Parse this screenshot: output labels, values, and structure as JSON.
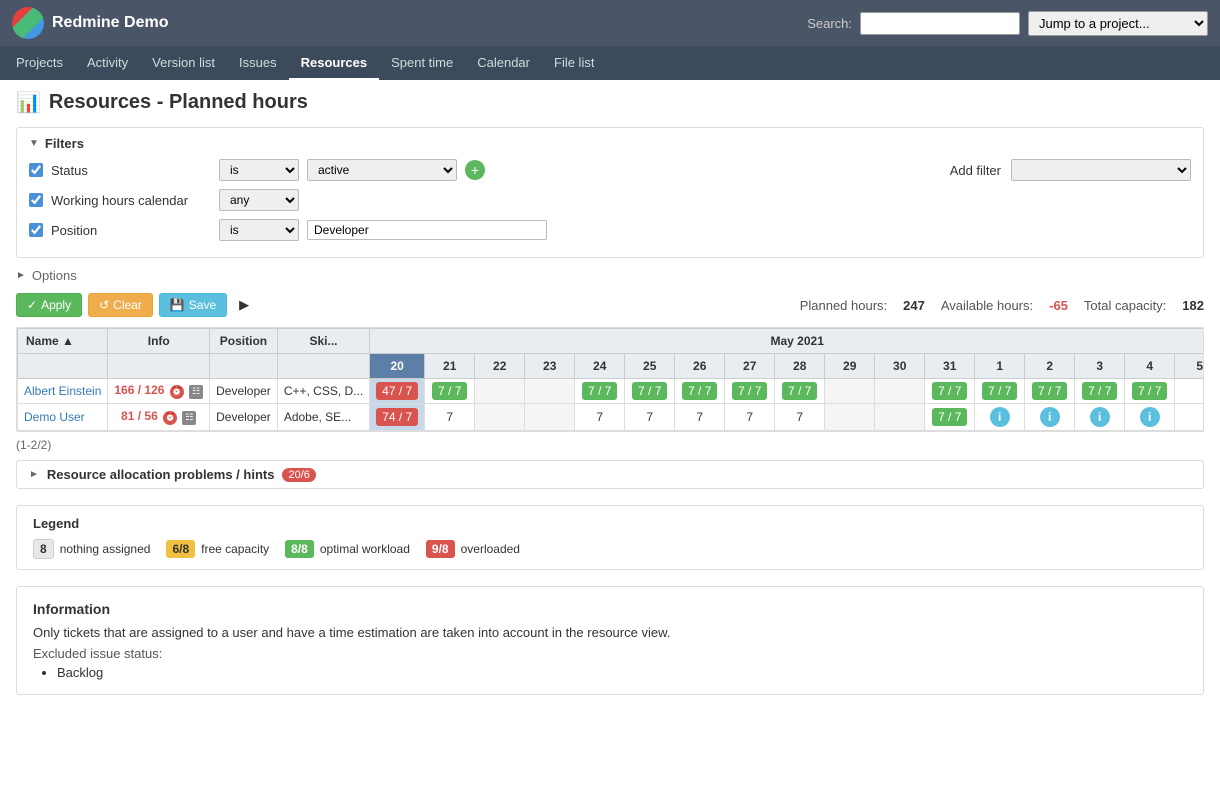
{
  "app": {
    "title": "Redmine Demo",
    "search_label": "Search:",
    "search_placeholder": "",
    "jump_placeholder": "Jump to a project..."
  },
  "nav": {
    "items": [
      {
        "label": "Projects",
        "active": false
      },
      {
        "label": "Activity",
        "active": false
      },
      {
        "label": "Version list",
        "active": false
      },
      {
        "label": "Issues",
        "active": false
      },
      {
        "label": "Resources",
        "active": true
      },
      {
        "label": "Spent time",
        "active": false
      },
      {
        "label": "Calendar",
        "active": false
      },
      {
        "label": "File list",
        "active": false
      }
    ]
  },
  "page": {
    "title": "Resources - Planned hours"
  },
  "filters": {
    "section_label": "Filters",
    "add_filter_label": "Add filter",
    "rows": [
      {
        "id": "status",
        "checked": true,
        "label": "Status",
        "operator": "is",
        "value_type": "select",
        "value": "active"
      },
      {
        "id": "working_hours",
        "checked": true,
        "label": "Working hours calendar",
        "operator": "any",
        "value_type": "none",
        "value": ""
      },
      {
        "id": "position",
        "checked": true,
        "label": "Position",
        "operator": "is",
        "value_type": "text",
        "value": "Developer"
      }
    ]
  },
  "options": {
    "label": "Options"
  },
  "actions": {
    "apply": "Apply",
    "clear": "Clear",
    "save": "Save"
  },
  "stats": {
    "planned_label": "Planned hours:",
    "planned_value": "247",
    "available_label": "Available hours:",
    "available_value": "-65",
    "total_label": "Total capacity:",
    "total_value": "182"
  },
  "table": {
    "month_header": "May 2021",
    "col_headers": [
      "Name",
      "Info",
      "Position",
      "Skills",
      "20",
      "21",
      "22",
      "23",
      "24",
      "25",
      "26",
      "27",
      "28",
      "29",
      "30",
      "31",
      "1",
      "2",
      "3",
      "4",
      "5"
    ],
    "rows": [
      {
        "name": "Albert Einstein",
        "hours_display": "166 / 126",
        "position": "Developer",
        "skills": "C++, CSS, D...",
        "days": {
          "20": {
            "value": "47 / 7",
            "type": "today-red"
          },
          "21": {
            "value": "7 / 7",
            "type": "green"
          },
          "22": {
            "value": "",
            "type": "weekend"
          },
          "23": {
            "value": "",
            "type": "weekend"
          },
          "24": {
            "value": "7 / 7",
            "type": "green"
          },
          "25": {
            "value": "7 / 7",
            "type": "green"
          },
          "26": {
            "value": "7 / 7",
            "type": "green"
          },
          "27": {
            "value": "7 / 7",
            "type": "green"
          },
          "28": {
            "value": "7 / 7",
            "type": "green"
          },
          "29": {
            "value": "",
            "type": "weekend"
          },
          "30": {
            "value": "",
            "type": "weekend"
          },
          "31": {
            "value": "7 / 7",
            "type": "green"
          },
          "1": {
            "value": "7 / 7",
            "type": "green"
          },
          "2": {
            "value": "7 / 7",
            "type": "green"
          },
          "3": {
            "value": "7 / 7",
            "type": "green"
          },
          "4": {
            "value": "7 / 7",
            "type": "green"
          },
          "5": {
            "value": "",
            "type": "empty"
          }
        }
      },
      {
        "name": "Demo User",
        "hours_display": "81 / 56",
        "position": "Developer",
        "skills": "Adobe, SE...",
        "days": {
          "20": {
            "value": "74 / 7",
            "type": "today-red"
          },
          "21": {
            "value": "7",
            "type": "plain"
          },
          "22": {
            "value": "",
            "type": "weekend"
          },
          "23": {
            "value": "",
            "type": "weekend"
          },
          "24": {
            "value": "7",
            "type": "plain"
          },
          "25": {
            "value": "7",
            "type": "plain"
          },
          "26": {
            "value": "7",
            "type": "plain"
          },
          "27": {
            "value": "7",
            "type": "plain"
          },
          "28": {
            "value": "7",
            "type": "plain"
          },
          "29": {
            "value": "",
            "type": "weekend"
          },
          "30": {
            "value": "",
            "type": "weekend"
          },
          "31": {
            "value": "7 / 7",
            "type": "green"
          },
          "1": {
            "value": "ℹ",
            "type": "info"
          },
          "2": {
            "value": "ℹ",
            "type": "info"
          },
          "3": {
            "value": "ℹ",
            "type": "info"
          },
          "4": {
            "value": "ℹ",
            "type": "info"
          },
          "5": {
            "value": "",
            "type": "empty"
          }
        }
      }
    ],
    "row_count": "(1-2/2)"
  },
  "problems": {
    "label": "Resource allocation problems / hints",
    "count": "20/6"
  },
  "legend": {
    "title": "Legend",
    "items": [
      {
        "badge": "8",
        "type": "plain",
        "desc": "nothing assigned"
      },
      {
        "badge": "6/8",
        "type": "yellow",
        "desc": "free capacity"
      },
      {
        "badge": "8/8",
        "type": "green",
        "desc": "optimal workload"
      },
      {
        "badge": "9/8",
        "type": "red",
        "desc": "overloaded"
      }
    ]
  },
  "information": {
    "title": "Information",
    "text": "Only tickets that are assigned to a user and have a time estimation are taken into account in the resource view.",
    "excluded_label": "Excluded issue status:",
    "excluded_items": [
      "Backlog"
    ]
  }
}
